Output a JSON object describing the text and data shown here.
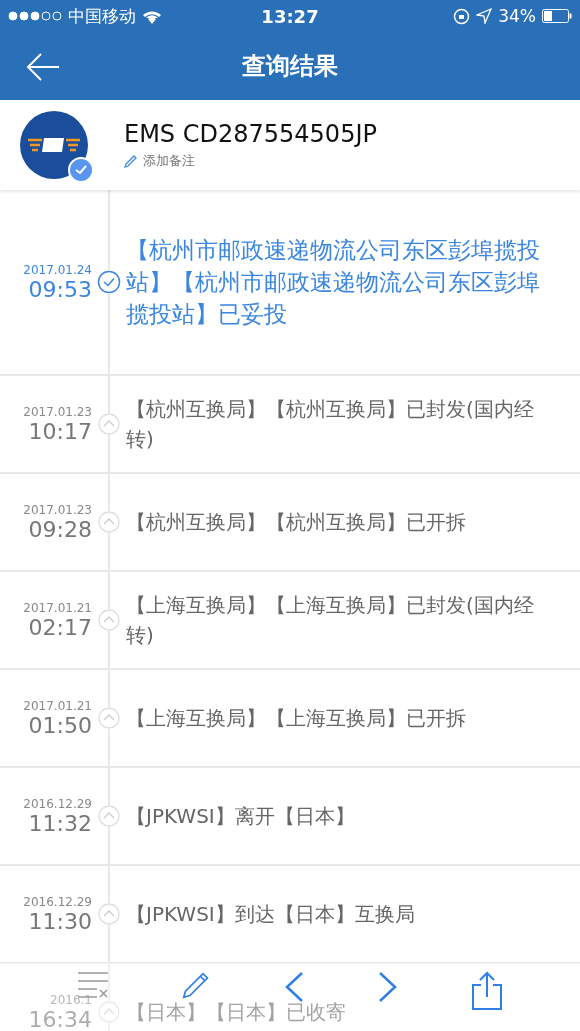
{
  "status_bar": {
    "carrier": "中国移动",
    "time": "13:27",
    "battery": "34%"
  },
  "nav": {
    "title": "查询结果"
  },
  "parcel": {
    "title": "EMS CD287554505JP",
    "note": "添加备注"
  },
  "events": [
    {
      "date": "2017.01.24",
      "time": "09:53",
      "text": "【杭州市邮政速递物流公司东区彭埠揽投站】【杭州市邮政速递物流公司东区彭埠揽投站】已妥投",
      "current": true
    },
    {
      "date": "2017.01.23",
      "time": "10:17",
      "text": "【杭州互换局】【杭州互换局】已封发(国内经转)",
      "current": false
    },
    {
      "date": "2017.01.23",
      "time": "09:28",
      "text": "【杭州互换局】【杭州互换局】已开拆",
      "current": false
    },
    {
      "date": "2017.01.21",
      "time": "02:17",
      "text": "【上海互换局】【上海互换局】已封发(国内经转)",
      "current": false
    },
    {
      "date": "2017.01.21",
      "time": "01:50",
      "text": "【上海互换局】【上海互换局】已开拆",
      "current": false
    },
    {
      "date": "2016.12.29",
      "time": "11:32",
      "text": "【JPKWSI】离开【日本】",
      "current": false
    },
    {
      "date": "2016.12.29",
      "time": "11:30",
      "text": "【JPKWSI】到达【日本】互换局",
      "current": false
    },
    {
      "date": "2016.1",
      "time": "16:34",
      "text": "【日本】【日本】已收寄",
      "current": false
    }
  ]
}
